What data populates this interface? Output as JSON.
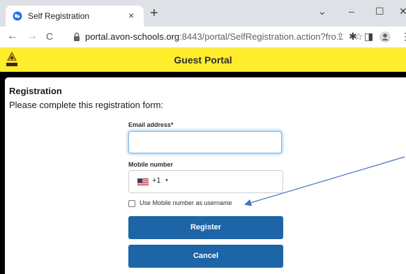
{
  "browser": {
    "tab_title": "Self Registration",
    "tab_close": "×",
    "new_tab": "+",
    "window_controls": {
      "minimize": "–",
      "maximize": "☐",
      "close": "✕",
      "tab_search": "⌄"
    },
    "nav": {
      "back": "←",
      "forward": "→",
      "reload": "C"
    },
    "url_host": "portal.avon-schools.org",
    "url_rest": ":8443/portal/SelfRegistration.action?fro...",
    "icons": {
      "share": "⇪",
      "bookmark": "☆",
      "extensions": "✱",
      "sidebar": "◨",
      "profile": "●",
      "menu": "⋮"
    }
  },
  "portal": {
    "title": "Guest Portal",
    "header_color": "#ffed2b",
    "logo_text": "AVON SC"
  },
  "form": {
    "heading": "Registration",
    "subheading": "Please complete this registration form:",
    "email_label": "Email address*",
    "email_value": "",
    "mobile_label": "Mobile number",
    "country_code": "+1",
    "country_caret": "▾",
    "use_mobile_label": "Use Mobile number as username",
    "use_mobile_checked": false,
    "register_label": "Register",
    "cancel_label": "Cancel",
    "button_color": "#1d65a6"
  },
  "annotation": {
    "arrow_color": "#4472c4"
  }
}
